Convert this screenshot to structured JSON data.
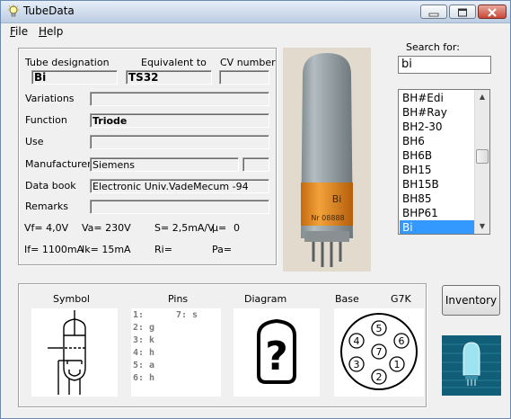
{
  "window": {
    "title": "TubeData"
  },
  "menu": [
    {
      "label": "File",
      "accel": "F"
    },
    {
      "label": "Help",
      "accel": "H"
    }
  ],
  "details": {
    "labels": {
      "designation": "Tube designation",
      "equivalent": "Equivalent to",
      "cv": "CV number",
      "variations": "Variations",
      "function": "Function",
      "use": "Use",
      "manufacturer": "Manufacturer",
      "databook": "Data book",
      "remarks": "Remarks"
    },
    "values": {
      "designation": "Bi",
      "equivalent": "TS32",
      "cv": "",
      "variations": "",
      "function": "Triode",
      "use": "",
      "manufacturer": "Siemens",
      "manufacturer_extra": "",
      "databook": "Electronic Univ.VadeMecum -94",
      "remarks": ""
    },
    "params": {
      "vf": "Vf= 4,0V",
      "va": "Va=  230V",
      "s": "S= 2,5mA/V",
      "mu": "µ=",
      "mu_val": "0",
      "if": "If= 1100mA",
      "ik": "Ik=  15mA",
      "ri": "Ri=",
      "pa": "Pa="
    }
  },
  "photo_text": {
    "label": "Bi",
    "serial": "Nr 08888"
  },
  "search": {
    "label": "Search for:",
    "value": "bi",
    "results": [
      "BH#Edi",
      "BH#Ray",
      "BH2-30",
      "BH6",
      "BH6B",
      "BH15",
      "BH15B",
      "BH85",
      "BHP61",
      "Bi"
    ],
    "selected": "Bi"
  },
  "bottom": {
    "symbol_label": "Symbol",
    "pins_label": "Pins",
    "diagram_label": "Diagram",
    "base_label": "Base",
    "base_type": "G7K",
    "pins_left": [
      "1:",
      "2: g",
      "3: k",
      "4: h",
      "5: a",
      "6: h"
    ],
    "pins_right": [
      "7: s"
    ],
    "diagram_glyph": "?",
    "base_pins": [
      "1",
      "2",
      "3",
      "4",
      "5",
      "6",
      "7"
    ]
  },
  "inventory_button": "Inventory",
  "icons": [
    "bulb-icon",
    "minimize-icon",
    "maximize-icon",
    "close-icon",
    "scroll-up-icon",
    "scroll-down-icon"
  ]
}
